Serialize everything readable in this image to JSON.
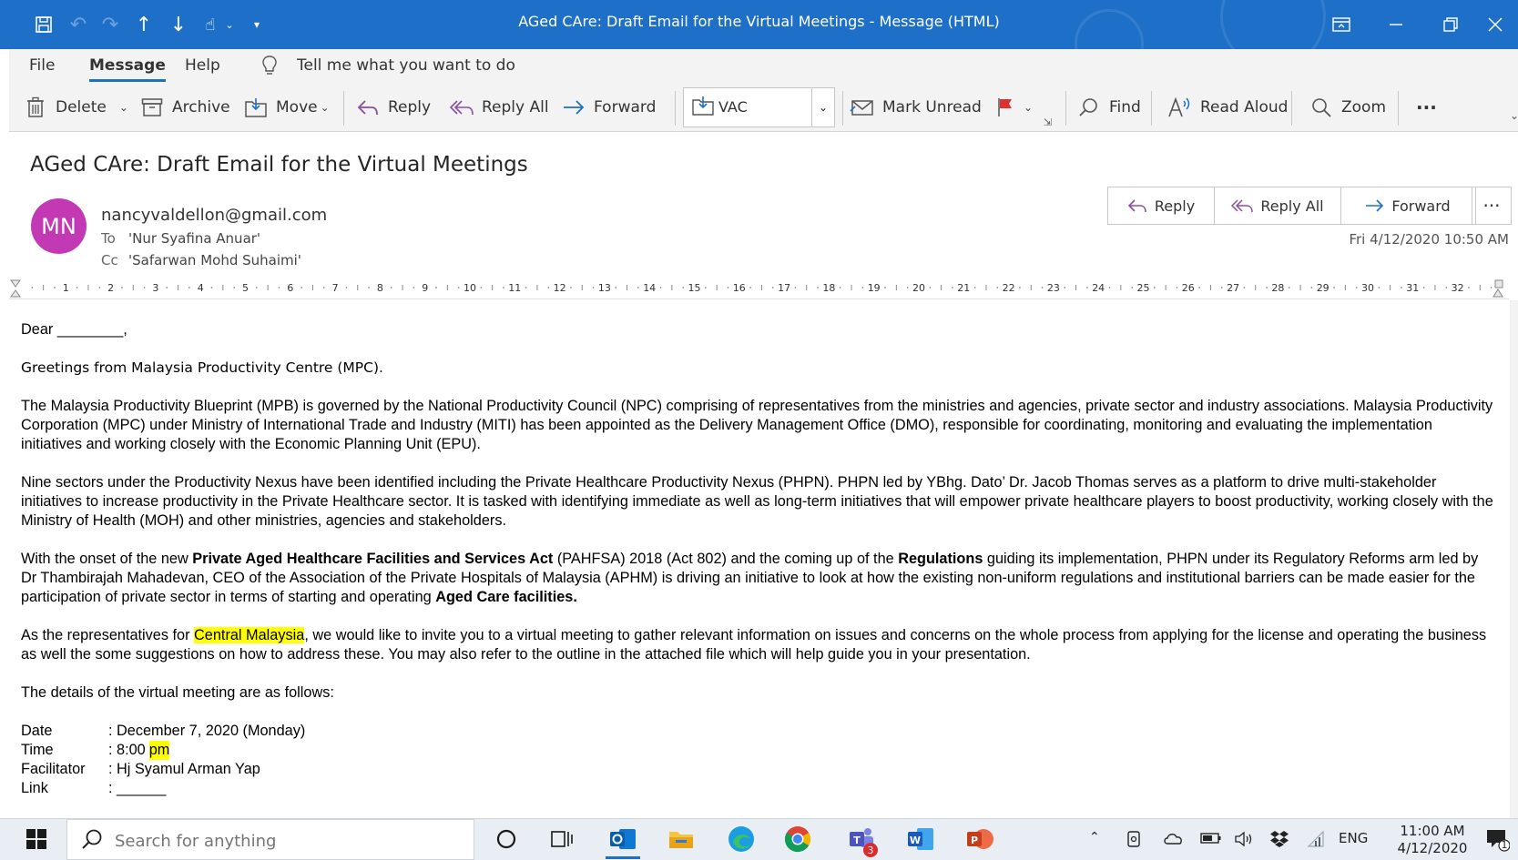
{
  "window": {
    "title": "AGed CAre: Draft Email for the Virtual Meetings  -  Message (HTML)"
  },
  "menu": {
    "items": [
      "File",
      "Message",
      "Help"
    ],
    "active": "Message",
    "tell_me": "Tell me what you want to do"
  },
  "ribbon": {
    "delete": "Delete",
    "archive": "Archive",
    "move": "Move",
    "reply": "Reply",
    "reply_all": "Reply All",
    "forward": "Forward",
    "quick_step": "VAC",
    "mark_unread": "Mark Unread",
    "find": "Find",
    "read_aloud": "Read Aloud",
    "zoom": "Zoom",
    "more": "···"
  },
  "message": {
    "subject": "AGed CAre: Draft Email for the Virtual Meetings",
    "avatar_initials": "MN",
    "avatar_color": "#c239b3",
    "sender": "nancyvaldellon@gmail.com",
    "to_label": "To",
    "to": "'Nur Syafina Anuar'",
    "cc_label": "Cc",
    "cc": "'Safarwan Mohd Suhaimi'",
    "date": "Fri 4/12/2020 10:50 AM",
    "actions": {
      "reply": "Reply",
      "reply_all": "Reply All",
      "forward": "Forward",
      "more": "···"
    }
  },
  "ruler": {
    "max_mark": 32
  },
  "body": {
    "salutation": "Dear ________,",
    "greeting": "Greetings from Malaysia Productivity Centre (MPC).",
    "para1": "The Malaysia Productivity Blueprint (MPB) is governed by the National Productivity Council (NPC) comprising of representatives from the ministries and agencies, private sector and industry associations. Malaysia Productivity Corporation (MPC) under Ministry of International Trade and Industry (MITI) has been appointed as the Delivery Management Office (DMO), responsible for coordinating, monitoring and evaluating the implementation initiatives and working closely with the Economic Planning Unit (EPU).",
    "para2": "Nine sectors under the Productivity Nexus have been identified including the Private Healthcare Productivity Nexus (PHPN). PHPN led by YBhg. Dato’ Dr. Jacob Thomas serves as a platform to drive multi-stakeholder initiatives to increase productivity in the Private Healthcare sector. It is tasked with identifying immediate as well as long-term initiatives that will empower private healthcare players to boost productivity, working closely with the Ministry of Health (MOH) and other ministries, agencies and stakeholders.",
    "para3": {
      "t1": "With the onset of the new ",
      "b1": "Private Aged Healthcare Facilities and Services Act",
      "t2": " (PAHFSA) 2018 (Act 802) and the coming up of the ",
      "b2": "Regulations",
      "t3": " guiding its implementation, PHPN under its Regulatory Reforms arm led by Dr Thambirajah Mahadevan, CEO of the Association of the Private Hospitals of Malaysia (APHM) is driving an initiative to look at how the existing non-uniform regulations and institutional barriers can be made easier for the participation of private sector in terms of starting and operating ",
      "b3": "Aged Care facilities."
    },
    "para4": {
      "t1": "As the representatives for ",
      "hl": "Central Malaysia",
      "t2": ", we would like to invite you to a virtual meeting to gather relevant information on issues and concerns on the whole process from applying for the license and operating the business as well the some suggestions on how to address these. You may also refer to the outline in the attached file which will help guide you in your presentation."
    },
    "details_intro": "The details of the virtual meeting are as follows:",
    "details": {
      "date_label": "Date",
      "date_value": ": December 7, 2020 (Monday)",
      "time_label": "Time",
      "time_value": ": 8:00",
      "time_hl": "pm",
      "facilitator_label": "Facilitator",
      "facilitator_value": ": Hj Syamul Arman Yap",
      "link_label": "Link",
      "link_value": ": ______"
    }
  },
  "taskbar": {
    "search_placeholder": "Search for anything",
    "teams_badge": "3",
    "language": "ENG",
    "time": "11:00 AM",
    "date": "4/12/2020",
    "notification_count": "1"
  }
}
